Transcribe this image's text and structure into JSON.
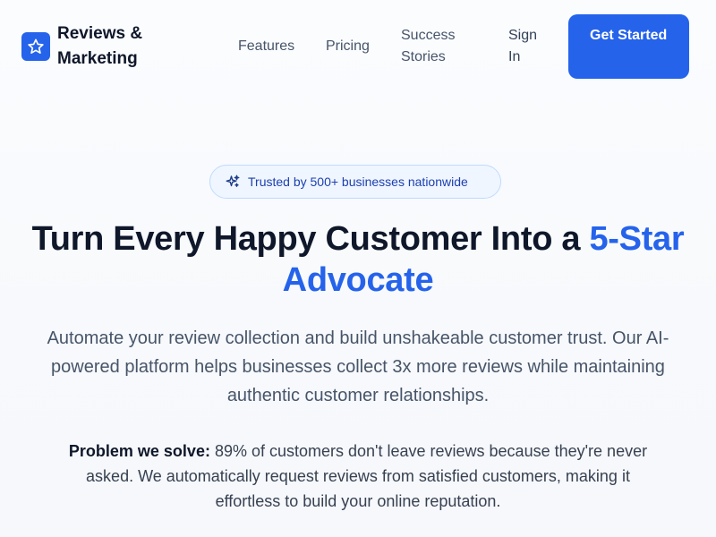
{
  "nav": {
    "brand_name": "Reviews & Marketing",
    "brand_icon": "star-icon",
    "links": [
      {
        "label": "Features"
      },
      {
        "label": "Pricing"
      },
      {
        "label": "Success Stories"
      }
    ],
    "sign_in": "Sign In",
    "cta": "Get Started"
  },
  "hero": {
    "badge_icon": "sparkles-icon",
    "badge_text": "Trusted by 500+ businesses nationwide",
    "title_main": "Turn Every Happy Customer Into a ",
    "title_accent": "5-Star Advocate",
    "subtitle": "Automate your review collection and build unshakeable customer trust. Our AI-powered platform helps businesses collect 3x more reviews while maintaining authentic customer relationships.",
    "problem_label": "Problem we solve:",
    "problem_text": " 89% of customers don't leave reviews because they're never asked. We automatically request reviews from satisfied customers, making it effortless to build your online reputation."
  },
  "colors": {
    "accent": "#2563eb",
    "heading": "#0f172a",
    "body_text": "#475569",
    "badge_bg": "#eff6ff",
    "badge_border": "#bfdbfe"
  }
}
